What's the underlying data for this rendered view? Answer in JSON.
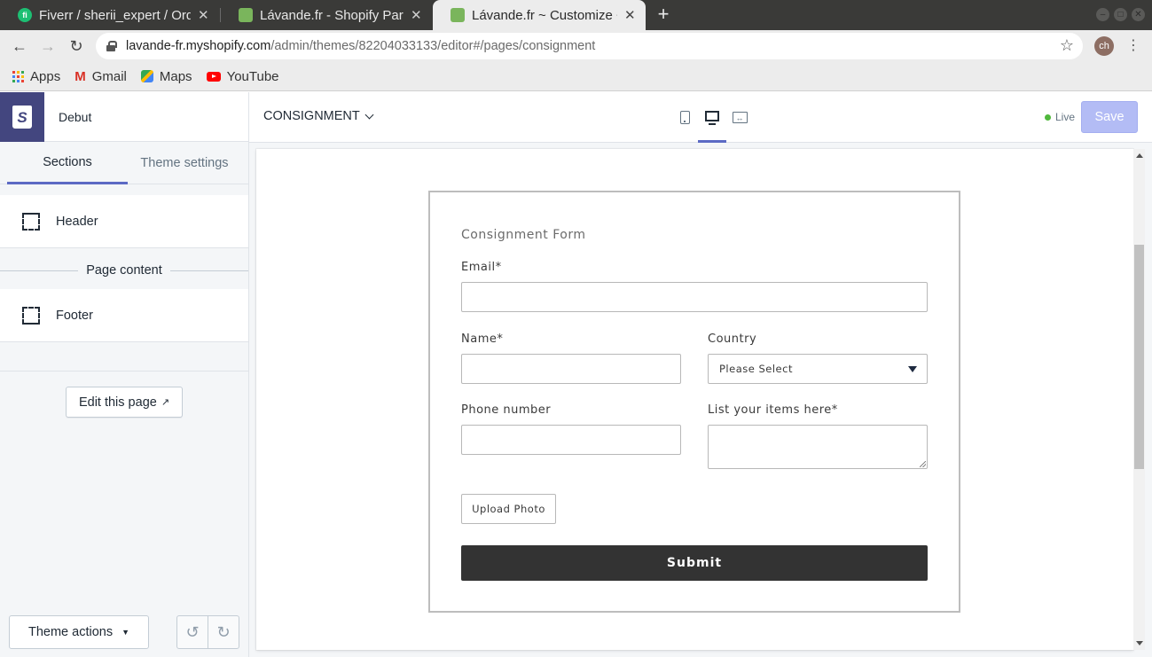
{
  "browser": {
    "tabs": [
      {
        "title": "Fiverr / sherii_expert / Orders",
        "icon": "fiverr-favicon",
        "active": false
      },
      {
        "title": "Lávande.fr - Shopify Partners",
        "icon": "shopify-favicon",
        "active": false
      },
      {
        "title": "Lávande.fr ~ Customize ~ Debut",
        "icon": "shopify-favicon",
        "active": true
      }
    ],
    "url_host": "lavande-fr.myshopify.com",
    "url_path": "/admin/themes/82204033133/editor#/pages/consignment",
    "profile_initials": "ch",
    "bookmarks": [
      {
        "label": "Apps",
        "icon": "apps-grid-icon"
      },
      {
        "label": "Gmail",
        "icon": "gmail-icon"
      },
      {
        "label": "Maps",
        "icon": "maps-icon"
      },
      {
        "label": "YouTube",
        "icon": "youtube-icon"
      }
    ]
  },
  "editor": {
    "theme_name": "Debut",
    "sidebar_tabs": [
      "Sections",
      "Theme settings"
    ],
    "active_sidebar_tab": "Sections",
    "sections": {
      "header": "Header",
      "page_content": "Page content",
      "footer": "Footer"
    },
    "edit_page_label": "Edit this page",
    "theme_actions_label": "Theme actions",
    "page_selector": "CONSIGNMENT",
    "active_device": "desktop",
    "live_label": "Live",
    "save_label": "Save",
    "colors": {
      "accent": "#5c6ac4",
      "shopify_brand": "#43467f",
      "save_disabled": "#b3bcf5",
      "live_green": "#50b83c"
    }
  },
  "form": {
    "title": "Consignment Form",
    "email_label": "Email*",
    "name_label": "Name*",
    "country_label": "Country",
    "country_value": "Please Select",
    "phone_label": "Phone number",
    "items_label": "List your items here*",
    "upload_label": "Upload Photo",
    "submit_label": "Submit",
    "colors": {
      "submit_bg": "#333333"
    }
  }
}
